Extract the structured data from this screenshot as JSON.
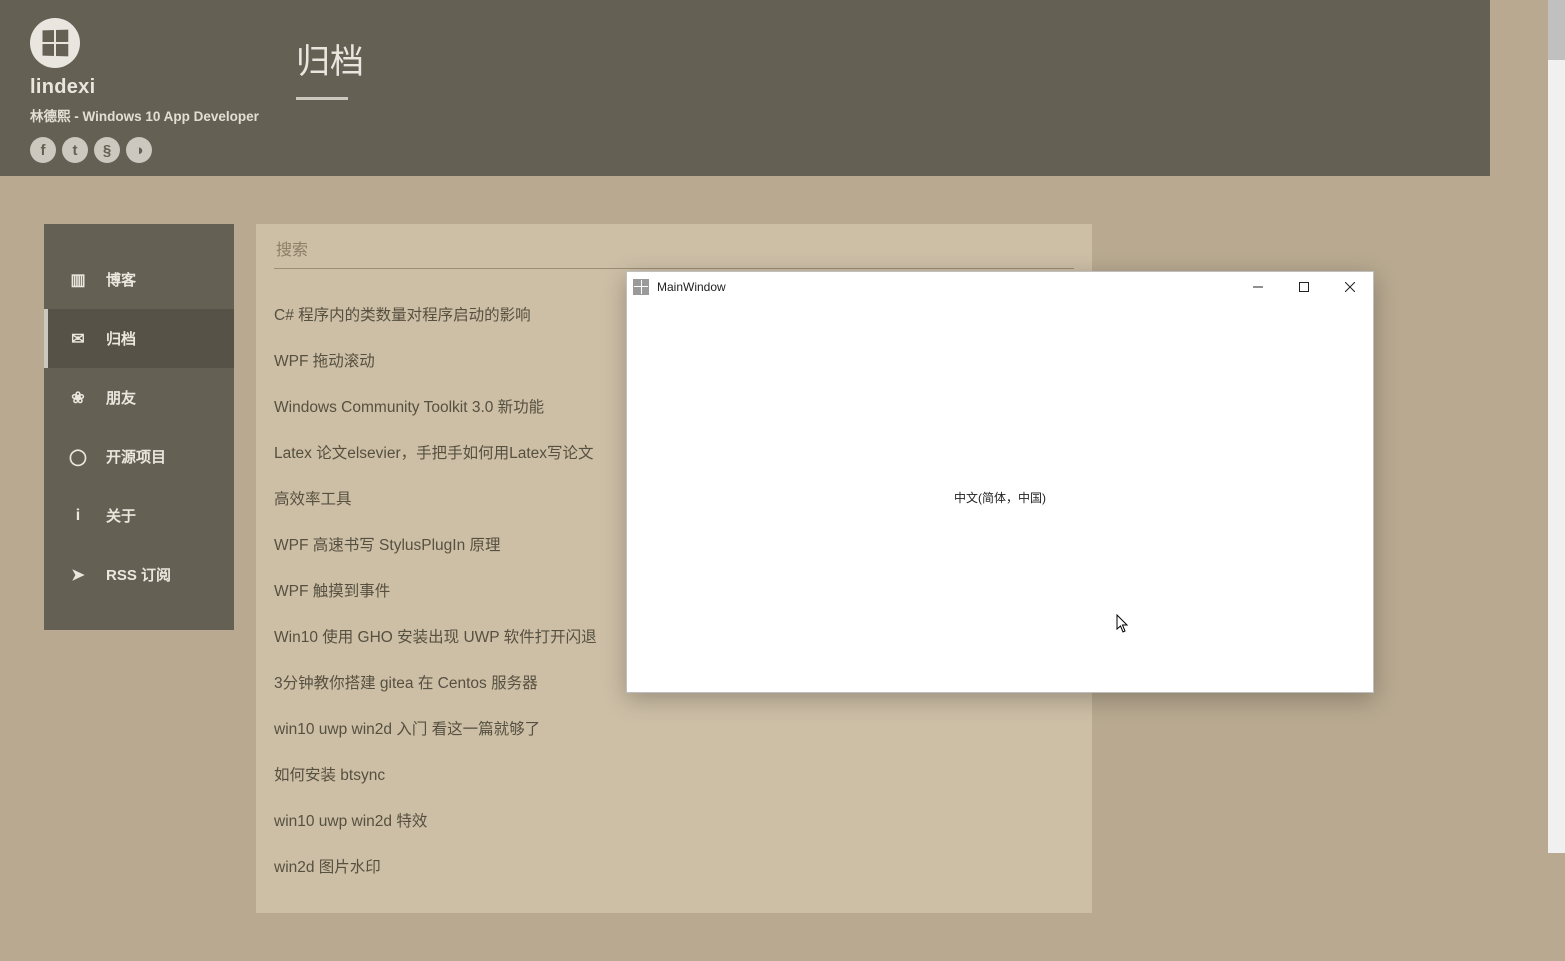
{
  "site": {
    "name": "lindexi",
    "subtitle": "林德熙 - Windows 10 App Developer"
  },
  "pageTitle": "归档",
  "socials": [
    {
      "name": "facebook-icon",
      "glyph": "f"
    },
    {
      "name": "twitter-icon",
      "glyph": "t"
    },
    {
      "name": "stackoverflow-icon",
      "glyph": "§"
    },
    {
      "name": "github-icon",
      "glyph": "◑"
    }
  ],
  "nav": {
    "activeIndex": 1,
    "items": [
      {
        "icon": "book-icon",
        "glyph": "▥",
        "label": "博客"
      },
      {
        "icon": "chat-icon",
        "glyph": "✉",
        "label": "归档"
      },
      {
        "icon": "friends-icon",
        "glyph": "❀",
        "label": "朋友"
      },
      {
        "icon": "github-icon",
        "glyph": "◯",
        "label": "开源项目"
      },
      {
        "icon": "info-icon",
        "glyph": "i",
        "label": "关于"
      },
      {
        "icon": "rss-icon",
        "glyph": "➤",
        "label": "RSS 订阅"
      }
    ]
  },
  "search": {
    "placeholder": "搜索"
  },
  "posts": [
    "C# 程序内的类数量对程序启动的影响",
    "WPF 拖动滚动",
    "Windows Community Toolkit 3.0 新功能",
    "Latex 论文elsevier，手把手如何用Latex写论文",
    "高效率工具",
    "WPF 高速书写 StylusPlugIn 原理",
    "WPF 触摸到事件",
    "Win10 使用 GHO 安装出现 UWP 软件打开闪退",
    "3分钟教你搭建 gitea 在 Centos 服务器",
    "win10 uwp win2d 入门 看这一篇就够了",
    "如何安装 btsync",
    "win10 uwp win2d 特效",
    "win2d 图片水印"
  ],
  "appWindow": {
    "title": "MainWindow",
    "content": "中文(简体，中国)"
  }
}
